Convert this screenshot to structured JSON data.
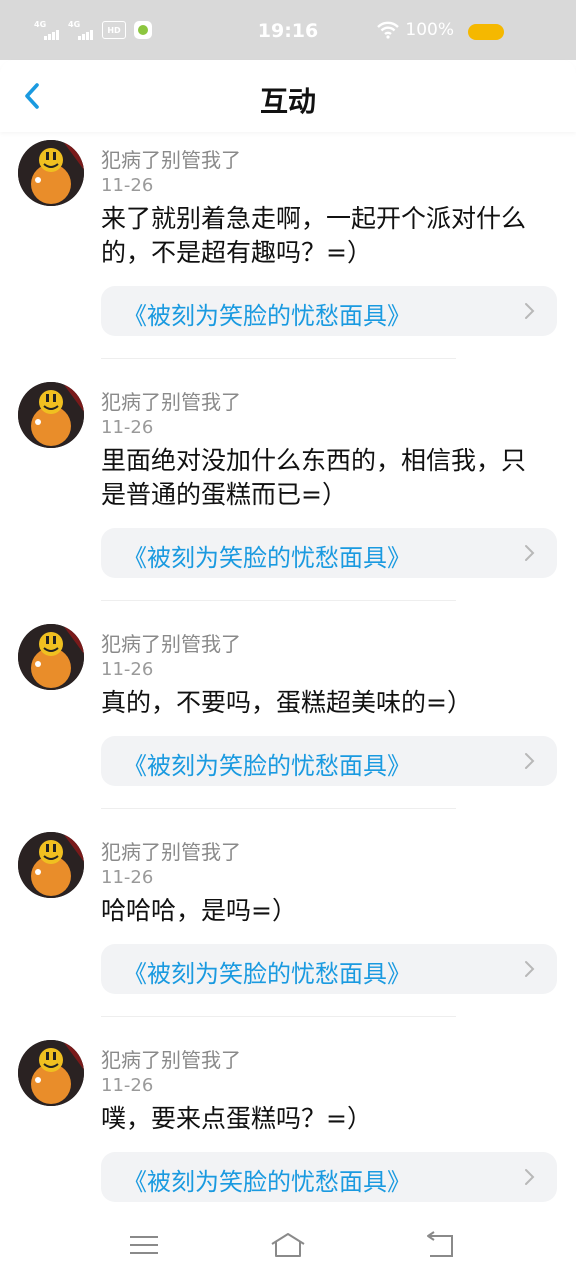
{
  "status_bar": {
    "network1": "4G",
    "network2": "4G",
    "hd": "HD",
    "time": "19:16",
    "battery": "100%"
  },
  "header": {
    "title": "互动"
  },
  "feed": [
    {
      "name": "犯病了别管我了",
      "date": "11-26",
      "text": "来了就别着急走啊，一起开个派对什么的，不是超有趣吗？=）",
      "link": "《被刻为笑脸的忧愁面具》"
    },
    {
      "name": "犯病了别管我了",
      "date": "11-26",
      "text": "里面绝对没加什么东西的，相信我，只是普通的蛋糕而已=）",
      "link": "《被刻为笑脸的忧愁面具》"
    },
    {
      "name": "犯病了别管我了",
      "date": "11-26",
      "text": "真的，不要吗，蛋糕超美味的=）",
      "link": "《被刻为笑脸的忧愁面具》"
    },
    {
      "name": "犯病了别管我了",
      "date": "11-26",
      "text": "哈哈哈，是吗=）",
      "link": "《被刻为笑脸的忧愁面具》"
    },
    {
      "name": "犯病了别管我了",
      "date": "11-26",
      "text": "噗，要来点蛋糕吗？=）",
      "link": "《被刻为笑脸的忧愁面具》"
    }
  ],
  "colors": {
    "accent": "#1a9ae0",
    "status_bar_bg": "#d9d9d9",
    "battery": "#f5b800",
    "card_bg": "#f2f3f5"
  },
  "icons": {
    "back": "chevron-left-icon",
    "card_arrow": "chevron-right-icon",
    "nav_menu": "menu-icon",
    "nav_home": "home-icon",
    "nav_back": "back-icon"
  }
}
